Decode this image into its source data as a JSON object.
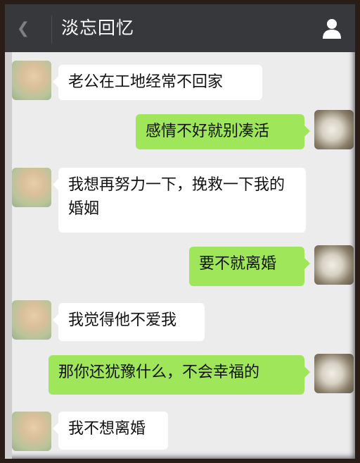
{
  "header": {
    "title": "淡忘回忆",
    "back_icon": "chevron-left-icon",
    "user_icon": "user-icon"
  },
  "colors": {
    "header_bg": "#36383b",
    "chat_bg": "#ececec",
    "sent_bubble": "#9fe65a",
    "received_bubble": "#ffffff"
  },
  "messages": [
    {
      "side": "received",
      "text": "老公在工地经常不回家"
    },
    {
      "side": "sent",
      "text": "感情不好就别凑活"
    },
    {
      "side": "received",
      "text": "我想再努力一下，挽救一下我的婚姻"
    },
    {
      "side": "sent",
      "text": "要不就离婚"
    },
    {
      "side": "received",
      "text": "我觉得他不爱我"
    },
    {
      "side": "sent",
      "text": "那你还犹豫什么，不会幸福的"
    },
    {
      "side": "received",
      "text": "我不想离婚"
    }
  ]
}
